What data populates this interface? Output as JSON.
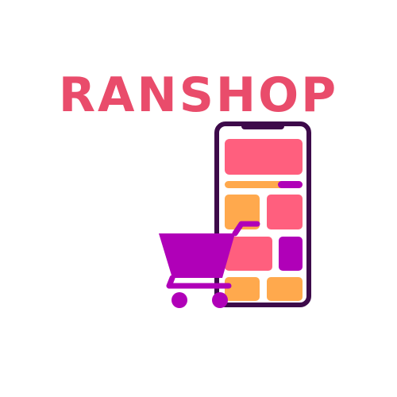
{
  "logo": {
    "brand_name": "RANSHOP",
    "icon": "smartphone-shopping-cart-icon"
  },
  "colors": {
    "brand_text": "#e94c6b",
    "phone_frame": "#3d0a4a",
    "pink": "#ff5f7e",
    "orange": "#ffa94d",
    "purple": "#b000b8"
  }
}
